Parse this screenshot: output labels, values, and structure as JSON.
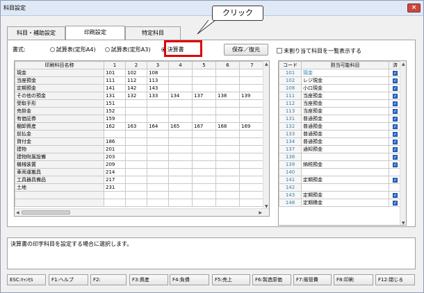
{
  "window": {
    "title": "科目設定",
    "close": "×"
  },
  "callout": "クリック",
  "tabs": [
    "科目・補助設定",
    "印刷設定",
    "特定科目"
  ],
  "format": {
    "label": "書式:",
    "options": [
      "試算表(定形A4)",
      "試算表(定形A3)",
      "決算書"
    ],
    "selected": "決算書"
  },
  "save_button": "保存／復元",
  "unassigned_label": "未割り当て科目を一覧表示する",
  "grid": {
    "headers": [
      "印刷科目名称",
      "1",
      "2",
      "3",
      "4",
      "5",
      "6",
      "7"
    ],
    "rows": [
      [
        "現金",
        "101",
        "102",
        "108",
        "",
        "",
        "",
        ""
      ],
      [
        "当座預金",
        "111",
        "112",
        "113",
        "",
        "",
        "",
        ""
      ],
      [
        "定期預金",
        "141",
        "142",
        "143",
        "",
        "",
        "",
        ""
      ],
      [
        "その他の預金",
        "131",
        "132",
        "133",
        "134",
        "137",
        "138",
        "139"
      ],
      [
        "受取手形",
        "151",
        "",
        "",
        "",
        "",
        "",
        ""
      ],
      [
        "売掛金",
        "152",
        "",
        "",
        "",
        "",
        "",
        ""
      ],
      [
        "有価証券",
        "159",
        "",
        "",
        "",
        "",
        "",
        ""
      ],
      [
        "棚卸資産",
        "162",
        "163",
        "164",
        "165",
        "167",
        "168",
        "169"
      ],
      [
        "前払金",
        "",
        "",
        "",
        "",
        "",
        "",
        ""
      ],
      [
        "貸付金",
        "186",
        "",
        "",
        "",
        "",
        "",
        ""
      ],
      [
        "建物",
        "201",
        "",
        "",
        "",
        "",
        "",
        ""
      ],
      [
        "建物附属設備",
        "203",
        "",
        "",
        "",
        "",
        "",
        ""
      ],
      [
        "機械装置",
        "209",
        "",
        "",
        "",
        "",
        "",
        ""
      ],
      [
        "車両運搬具",
        "214",
        "",
        "",
        "",
        "",
        "",
        ""
      ],
      [
        "工具器具備品",
        "217",
        "",
        "",
        "",
        "",
        "",
        ""
      ],
      [
        "土地",
        "231",
        "",
        "",
        "",
        "",
        "",
        ""
      ],
      [
        "",
        "",
        "",
        "",
        "",
        "",
        "",
        ""
      ],
      [
        "",
        "",
        "",
        "",
        "",
        "",
        "",
        ""
      ]
    ]
  },
  "assign": {
    "headers": [
      "コード",
      "割当可能科目",
      "済"
    ],
    "rows": [
      [
        "101",
        "現金",
        "✓"
      ],
      [
        "102",
        "レジ現金",
        "✓"
      ],
      [
        "108",
        "小口現金",
        "✓"
      ],
      [
        "111",
        "当座預金",
        "✓"
      ],
      [
        "112",
        "当座預金",
        "✓"
      ],
      [
        "113",
        "当座預金",
        "✓"
      ],
      [
        "131",
        "普通預金",
        "✓"
      ],
      [
        "132",
        "普通預金",
        "✓"
      ],
      [
        "133",
        "普通預金",
        "✓"
      ],
      [
        "134",
        "普通預金",
        "✓"
      ],
      [
        "137",
        "通知預金",
        "✓"
      ],
      [
        "138",
        "",
        "✓"
      ],
      [
        "139",
        "納税預金",
        "✓"
      ],
      [
        "140",
        "",
        ""
      ],
      [
        "141",
        "定期預金",
        "✓"
      ],
      [
        "142",
        "",
        ""
      ],
      [
        "143",
        "定期預金",
        "✓"
      ],
      [
        "148",
        "定期積金",
        "✓"
      ]
    ]
  },
  "message": "決算書の印字科目を設定する場合に選択します。",
  "fkeys": [
    "ESC:ｷｬﾝｾﾙ",
    "F1:ヘルプ",
    "F2:",
    "F3:資産",
    "F4:負債",
    "F5:売上",
    "F6:製造原価",
    "F7:販管費",
    "F8:印刷",
    "F12:閉じる"
  ],
  "colors": {
    "accent": "#e00000",
    "code_blue": "#2f7fb0",
    "check_blue": "#2e6bd1"
  }
}
